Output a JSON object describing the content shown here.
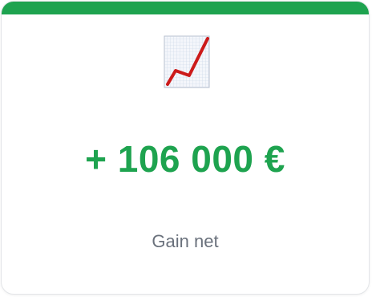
{
  "card": {
    "icon": "chart-increasing-icon",
    "amount": "+ 106 000 €",
    "label": "Gain net"
  },
  "colors": {
    "accent": "#1ea34f",
    "amount": "#1ea34f",
    "label": "#6a717c",
    "icon_line": "#cc1a1a"
  }
}
